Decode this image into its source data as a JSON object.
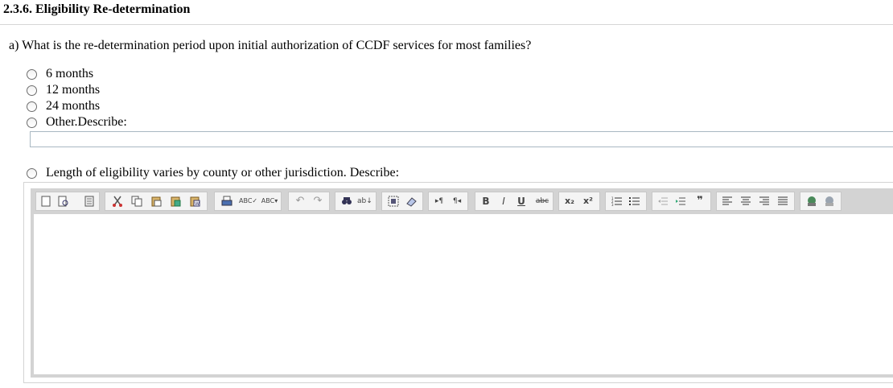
{
  "section": {
    "title": "2.3.6. Eligibility Re-determination"
  },
  "question": {
    "text": "a) What is the re-determination period upon initial authorization of CCDF services for most families?",
    "options": [
      {
        "label": "6 months",
        "selected": false
      },
      {
        "label": "12 months",
        "selected": false
      },
      {
        "label": "24 months",
        "selected": false
      },
      {
        "label": "Other.Describe:",
        "selected": false
      }
    ],
    "other_value": "",
    "varies_option": {
      "label": "Length of eligibility varies by county or other jurisdiction. Describe:",
      "selected": false
    }
  },
  "editor": {
    "content": "",
    "toolbar": [
      "new-page-icon",
      "preview-icon",
      "templates-icon",
      "cut-icon",
      "copy-icon",
      "paste-icon",
      "paste-text-icon",
      "paste-word-icon",
      "print-icon",
      "spellcheck-icon",
      "spellcheck-dropdown-icon",
      "undo-icon",
      "redo-icon",
      "find-icon",
      "replace-icon",
      "select-all-icon",
      "remove-format-icon",
      "ltr-icon",
      "rtl-icon",
      "bold-icon",
      "italic-icon",
      "underline-icon",
      "strike-icon",
      "subscript-icon",
      "superscript-icon",
      "numbered-list-icon",
      "bulleted-list-icon",
      "outdent-icon",
      "indent-icon",
      "blockquote-icon",
      "align-left-icon",
      "align-center-icon",
      "align-right-icon",
      "align-justify-icon",
      "link-icon",
      "unlink-icon"
    ]
  }
}
